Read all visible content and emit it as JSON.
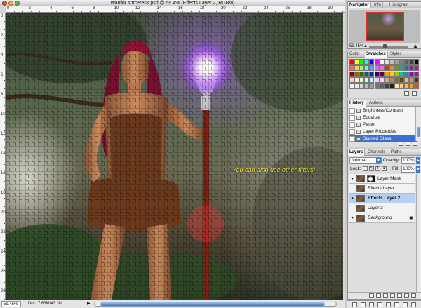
{
  "window": {
    "title": "Warrior sorceress.psd @ 59.4% (Effects Layer 2, RGB/8)"
  },
  "rulers": {
    "top": [
      "0",
      "2",
      "4",
      "6",
      "8",
      "10",
      "12",
      "14",
      "16",
      "18",
      "20",
      "22",
      "24",
      "26",
      "28",
      "30"
    ],
    "left": [
      "0",
      "2",
      "4",
      "6",
      "8",
      "10",
      "12",
      "14",
      "16",
      "18",
      "20",
      "22",
      "24",
      "26",
      "28"
    ]
  },
  "canvas": {
    "overlay_text": "You can also use other filters!"
  },
  "status": {
    "zoom": "59.45%",
    "doc_size": "Doc: 7.63M/43.2M",
    "arrow": "▶"
  },
  "navigator": {
    "tabs": [
      "Navigator",
      "Info",
      "Histogram"
    ],
    "active_tab": "Navigator",
    "zoom": "59.45%"
  },
  "swatches": {
    "tabs": [
      "Color",
      "Swatches",
      "Styles"
    ],
    "active_tab": "Swatches",
    "colors": [
      "#ff0000",
      "#ffff00",
      "#00ff00",
      "#00ffff",
      "#0000ff",
      "#ff00ff",
      "#ffffff",
      "#e0e0e0",
      "#c0c0c0",
      "#a0a0a0",
      "#808080",
      "#606060",
      "#404040",
      "#000000",
      "#ff6666",
      "#ffcc66",
      "#99ff66",
      "#66ffcc",
      "#6699ff",
      "#cc66ff",
      "#ff66cc",
      "#cc3333",
      "#cc9933",
      "#669933",
      "#339999",
      "#336699",
      "#663399",
      "#993366",
      "#990000",
      "#996600",
      "#336600",
      "#006666",
      "#003399",
      "#330066",
      "#660033",
      "#ff9900",
      "#ffcc00",
      "#99cc00",
      "#00cc99",
      "#0099cc",
      "#9900cc",
      "#cc0099",
      "#ffcccc",
      "#ffeecc",
      "#eeffcc",
      "#ccffee",
      "#cceeff",
      "#eeccff",
      "#ffccee",
      "#ccaa88",
      "#aa8866",
      "#886644",
      "#664422",
      "#ddbb99",
      "#bb9977",
      "#553311",
      "#f5f5f5",
      "#ebebeb",
      "#d6d6d6",
      "#bdbdbd",
      "#9e9e9e",
      "#757575",
      "#616161",
      "#424242",
      "#212121",
      "#ffe0b2",
      "#ffcc80",
      "#ffb74d",
      "#ff9800",
      "#e65100"
    ]
  },
  "history": {
    "tabs": [
      "History",
      "Actions"
    ],
    "active_tab": "History",
    "items": [
      {
        "label": "Brightness/Contrast",
        "selected": false
      },
      {
        "label": "Equalize",
        "selected": false
      },
      {
        "label": "Paste",
        "selected": false
      },
      {
        "label": "Layer Properties",
        "selected": false
      },
      {
        "label": "Stained Glass",
        "selected": true
      }
    ]
  },
  "layers": {
    "tabs": [
      "Layers",
      "Channels",
      "Paths"
    ],
    "active_tab": "Layers",
    "blend_mode": "Normal",
    "opacity_label": "Opacity:",
    "opacity": "100%",
    "lock_label": "Lock:",
    "fill_label": "Fill:",
    "fill": "100%",
    "items": [
      {
        "name": "Layer Mask",
        "visible": true,
        "has_mask": true,
        "selected": false,
        "italic": false,
        "locked": false
      },
      {
        "name": "Effects Layer",
        "visible": false,
        "has_mask": false,
        "selected": false,
        "italic": false,
        "locked": false
      },
      {
        "name": "Effects Layer 2",
        "visible": true,
        "has_mask": false,
        "selected": true,
        "italic": false,
        "locked": false
      },
      {
        "name": "Layer 3",
        "visible": false,
        "has_mask": false,
        "selected": false,
        "italic": false,
        "locked": false
      },
      {
        "name": "Background",
        "visible": true,
        "has_mask": false,
        "selected": false,
        "italic": true,
        "locked": true
      }
    ]
  },
  "colors": {
    "selection_blue": "#3d6fd0",
    "layer_selected": "#b7cff2",
    "overlay_text": "#f1e23a",
    "nav_view_box": "#e0302e"
  }
}
